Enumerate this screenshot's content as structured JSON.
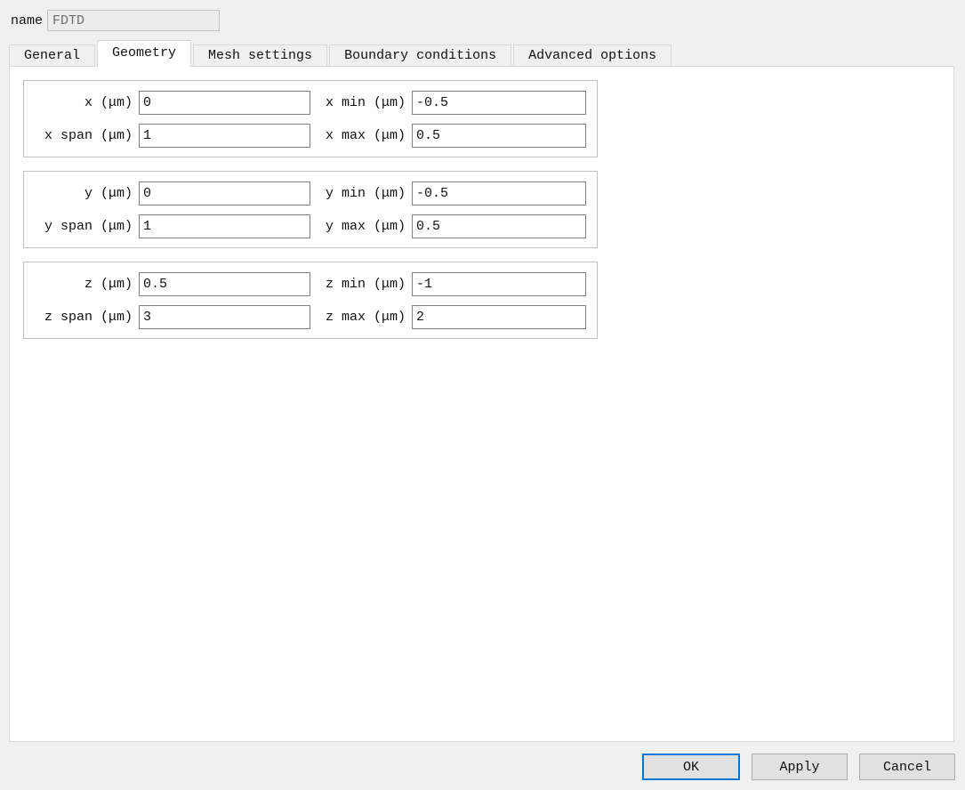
{
  "colors": {
    "dialog_bg": "#f0f0f0",
    "panel_bg": "#ffffff",
    "accent_blue": "#0078d7",
    "button_bg": "#e1e1e1",
    "input_border": "#7f7f7f",
    "groupbox_border": "#c0c0c0",
    "disabled_text": "#6e6e6e"
  },
  "header": {
    "name_label": "name",
    "name_value": "FDTD"
  },
  "tabs": [
    {
      "label": "General",
      "active": false
    },
    {
      "label": "Geometry",
      "active": true
    },
    {
      "label": "Mesh settings",
      "active": false
    },
    {
      "label": "Boundary conditions",
      "active": false
    },
    {
      "label": "Advanced options",
      "active": false
    }
  ],
  "geometry": {
    "groups": [
      {
        "axis": "x",
        "fields": [
          {
            "label": "x (μm)",
            "value": "0"
          },
          {
            "label": "x min (μm)",
            "value": "-0.5"
          },
          {
            "label": "x span (μm)",
            "value": "1"
          },
          {
            "label": "x max (μm)",
            "value": "0.5"
          }
        ]
      },
      {
        "axis": "y",
        "fields": [
          {
            "label": "y (μm)",
            "value": "0"
          },
          {
            "label": "y min (μm)",
            "value": "-0.5"
          },
          {
            "label": "y span (μm)",
            "value": "1"
          },
          {
            "label": "y max (μm)",
            "value": "0.5"
          }
        ]
      },
      {
        "axis": "z",
        "fields": [
          {
            "label": "z (μm)",
            "value": "0.5"
          },
          {
            "label": "z min (μm)",
            "value": "-1"
          },
          {
            "label": "z span (μm)",
            "value": "3"
          },
          {
            "label": "z max (μm)",
            "value": "2"
          }
        ]
      }
    ]
  },
  "footer": {
    "ok_label": "OK",
    "apply_label": "Apply",
    "cancel_label": "Cancel"
  }
}
